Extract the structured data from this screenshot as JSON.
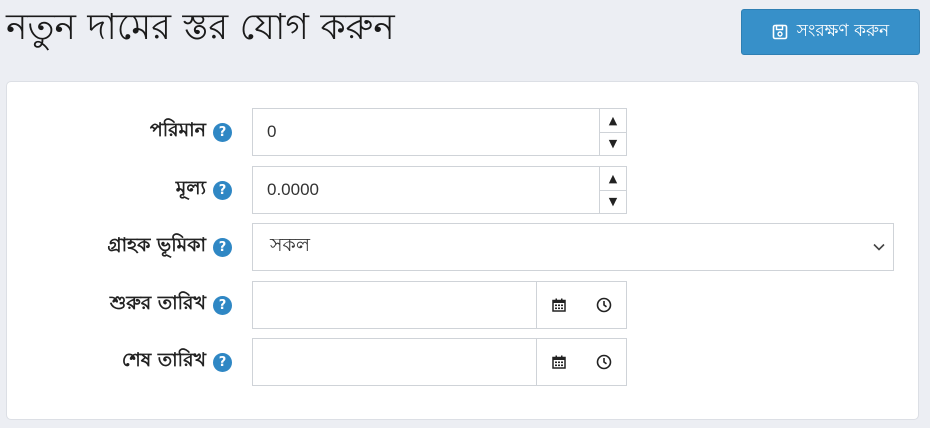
{
  "header": {
    "title": "নতুন দামের স্তর যোগ করুন",
    "save_label": "সংরক্ষণ করুন"
  },
  "form": {
    "quantity": {
      "label": "পরিমান",
      "value": "0"
    },
    "price": {
      "label": "মূল্য",
      "value": "0.0000"
    },
    "customer_role": {
      "label": "গ্রাহক ভূমিকা",
      "selected": "সকল"
    },
    "start_date": {
      "label": "শুরুর তারিখ",
      "value": ""
    },
    "end_date": {
      "label": "শেষ তারিখ",
      "value": ""
    }
  },
  "icons": {
    "save": "floppy-disk-icon",
    "help": "question-circle-icon",
    "calendar": "calendar-icon",
    "clock": "clock-icon",
    "chevron": "chevron-down-icon"
  },
  "colors": {
    "accent": "#3790c9",
    "help": "#2f87c4",
    "background": "#eceef3"
  }
}
